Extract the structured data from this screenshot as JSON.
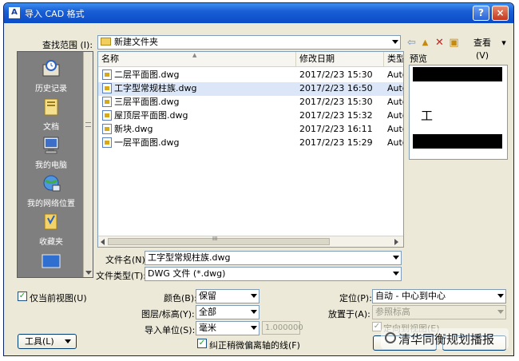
{
  "window": {
    "title": "导入 CAD 格式",
    "app_icon_glyph": "A",
    "help_glyph": "?",
    "close_glyph": "×"
  },
  "lookin": {
    "label": "查找范围 (I):",
    "value": "新建文件夹",
    "icon": "folder-icon"
  },
  "toolbar": {
    "back_glyph": "⇦",
    "up_glyph": "▲",
    "delete_glyph": "✕",
    "newfolder_glyph": "▣",
    "views_label": "查看(V)",
    "views_arrow": "▾"
  },
  "places": [
    {
      "label": "历史记录",
      "icon": "history-icon"
    },
    {
      "label": "文档",
      "icon": "documents-icon"
    },
    {
      "label": "我的电脑",
      "icon": "my-computer-icon"
    },
    {
      "label": "我的网络位置",
      "icon": "network-places-icon"
    },
    {
      "label": "收藏夹",
      "icon": "favorites-icon"
    }
  ],
  "filelist": {
    "columns": [
      "名称",
      "修改日期",
      "类型"
    ],
    "sort_glyph": "▲",
    "scroll_grip": "III",
    "rows": [
      {
        "name": "二层平面图.dwg",
        "date": "2017/2/23 15:30",
        "type": "Autc"
      },
      {
        "name": "工字型常规柱族.dwg",
        "date": "2017/2/23 16:50",
        "type": "Autc"
      },
      {
        "name": "三层平面图.dwg",
        "date": "2017/2/23 15:30",
        "type": "Autc"
      },
      {
        "name": "屋顶层平面图.dwg",
        "date": "2017/2/23 15:32",
        "type": "Autc"
      },
      {
        "name": "新块.dwg",
        "date": "2017/2/23 16:11",
        "type": "Autc"
      },
      {
        "name": "一层平面图.dwg",
        "date": "2017/2/23 15:29",
        "type": "Autc"
      }
    ],
    "selected_index": 1
  },
  "preview": {
    "label": "预览",
    "glyph": "工"
  },
  "filename": {
    "label": "文件名(N):",
    "value": "工字型常规柱族.dwg"
  },
  "filetype": {
    "label": "文件类型(T):",
    "value": "DWG 文件 (*.dwg)"
  },
  "options": {
    "current_view_only": {
      "label": "仅当前视图(U)",
      "checked": true
    },
    "color": {
      "label": "颜色(B):",
      "value": "保留"
    },
    "layers": {
      "label": "图层/标高(Y):",
      "value": "全部"
    },
    "import_units": {
      "label": "导入单位(S):",
      "value": "毫米",
      "factor": "1.000000"
    },
    "correct_lines": {
      "label": "纠正稍微偏离轴的线(F)",
      "checked": true
    },
    "positioning": {
      "label": "定位(P):",
      "value": "自动 - 中心到中心"
    },
    "place_at": {
      "label": "放置于(A):",
      "value": "参照标高"
    },
    "orient_to_view": {
      "label": "定向到视图(E)",
      "checked": true
    }
  },
  "tools_button": {
    "label": "工具(L)"
  },
  "watermark": {
    "text": "清华同衡规划播报"
  },
  "colors": {
    "titlebar": "#0b4bc7",
    "dialog_bg": "#ece9d8",
    "selection": "#dbe7f9",
    "places_bg": "#7f7f7f"
  }
}
